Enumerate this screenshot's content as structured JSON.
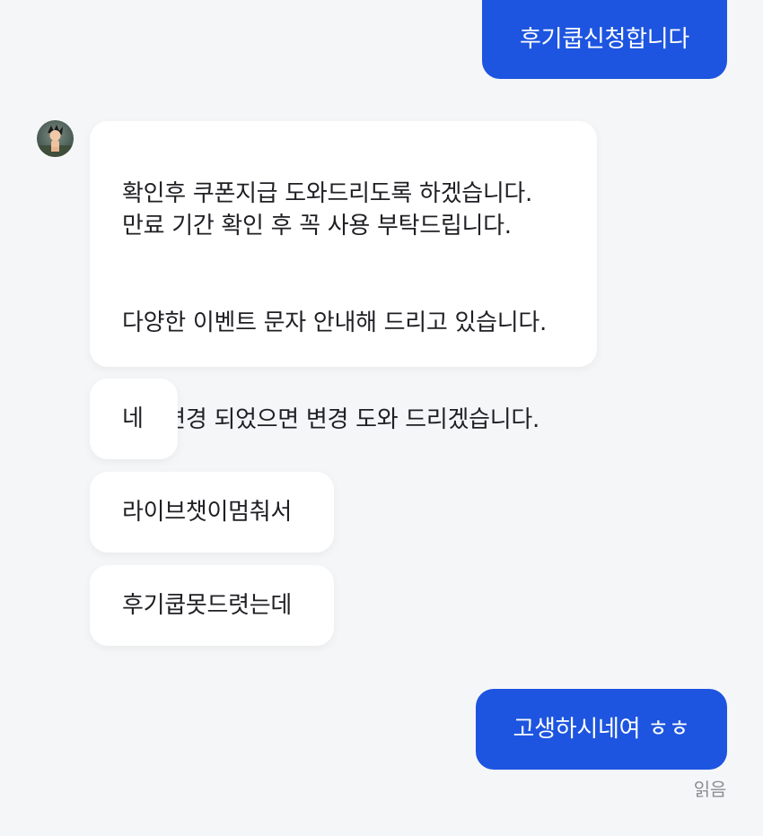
{
  "messages": {
    "m1": "후기쿱신청합니다",
    "m2": [
      "확인후 쿠폰지급 도와드리도록 하겠습니다.\n만료 기간 확인 후 꼭 사용 부탁드립니다.",
      "다양한 이벤트 문자 안내해 드리고 있습니다.",
      "번호변경 되었으면 변경 도와 드리겠습니다."
    ],
    "m3": "네",
    "m4": "라이브챗이멈춰서",
    "m5": "후기쿱못드렷는데",
    "m6": "고생하시네여 ㅎㅎ"
  },
  "status": {
    "read_label": "읽음"
  },
  "avatar": {
    "icon": "profile-avatar"
  },
  "colors": {
    "outgoing_bubble": "#1d55e0",
    "incoming_bubble": "#ffffff",
    "background": "#f5f6f8"
  }
}
